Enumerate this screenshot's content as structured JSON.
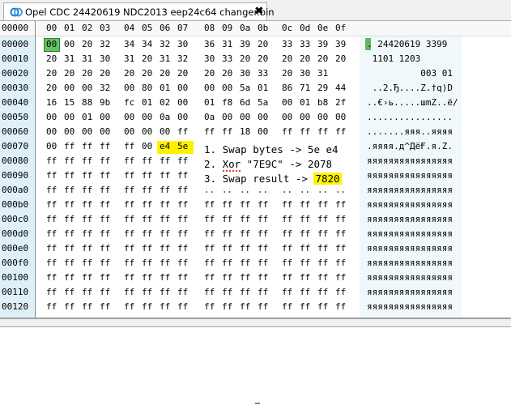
{
  "tab": {
    "title": "Opel CDC 24420619 NDC2013 eep24c64 changer.bin",
    "close": "✖"
  },
  "header": {
    "corner": "00000",
    "cols": [
      "00",
      "01",
      "02",
      "03",
      "04",
      "05",
      "06",
      "07",
      "08",
      "09",
      "0a",
      "0b",
      "0c",
      "0d",
      "0e",
      "0f"
    ]
  },
  "rows": [
    {
      "addr": "00000",
      "hex": [
        "00",
        "00",
        "20",
        "32",
        "34",
        "34",
        "32",
        "30",
        "36",
        "31",
        "39",
        "20",
        "33",
        "33",
        "39",
        "39"
      ],
      "ascii": ". 24420619 3399"
    },
    {
      "addr": "00010",
      "hex": [
        "20",
        "31",
        "31",
        "30",
        "31",
        "20",
        "31",
        "32",
        "30",
        "33",
        "20",
        "20",
        "20",
        "20",
        "20",
        "20"
      ],
      "ascii": " 1101 1203"
    },
    {
      "addr": "00020",
      "hex": [
        "20",
        "20",
        "20",
        "20",
        "20",
        "20",
        "20",
        "20",
        "20",
        "20",
        "30",
        "33",
        "20",
        "30",
        "31"
      ],
      "ascii": "          003 01"
    },
    {
      "addr": "00030",
      "hex": [
        "20",
        "00",
        "00",
        "32",
        "00",
        "80",
        "01",
        "00",
        "00",
        "00",
        "5a",
        "01",
        "86",
        "71",
        "29",
        "44"
      ],
      "ascii": " ..2.Ђ....Z.†q)D"
    },
    {
      "addr": "00040",
      "hex": [
        "16",
        "15",
        "88",
        "9b",
        "fc",
        "01",
        "02",
        "00",
        "01",
        "f8",
        "6d",
        "5a",
        "00",
        "01",
        "b8",
        "2f"
      ],
      "ascii": "..€›ь.....шmZ..ё/"
    },
    {
      "addr": "00050",
      "hex": [
        "00",
        "00",
        "01",
        "00",
        "00",
        "00",
        "0a",
        "00",
        "0a",
        "00",
        "00",
        "00",
        "00",
        "00",
        "00",
        "00"
      ],
      "ascii": "................"
    },
    {
      "addr": "00060",
      "hex": [
        "00",
        "00",
        "00",
        "00",
        "00",
        "00",
        "00",
        "ff",
        "ff",
        "ff",
        "18",
        "00",
        "ff",
        "ff",
        "ff",
        "ff"
      ],
      "ascii": ".......яяя..яяяя"
    },
    {
      "addr": "00070",
      "hex": [
        "00",
        "ff",
        "ff",
        "ff",
        "ff",
        "00",
        "e4",
        "5e",
        "",
        "",
        "",
        "",
        "",
        "",
        "",
        ""
      ],
      "ascii": ".яяяя.д^ДёҒ.я.Z."
    },
    {
      "addr": "00080",
      "hex": [
        "ff",
        "ff",
        "ff",
        "ff",
        "ff",
        "ff",
        "ff",
        "ff",
        "",
        "",
        "",
        "",
        "",
        "",
        "",
        ""
      ],
      "ascii": "яяяяяяяяяяяяяяяя"
    },
    {
      "addr": "00090",
      "hex": [
        "ff",
        "ff",
        "ff",
        "ff",
        "ff",
        "ff",
        "ff",
        "ff",
        "",
        "",
        "",
        "",
        "",
        "",
        "",
        ""
      ],
      "ascii": "яяяяяяяяяяяяяяяя"
    },
    {
      "addr": "000a0",
      "hex": [
        "ff",
        "ff",
        "ff",
        "ff",
        "ff",
        "ff",
        "ff",
        "ff",
        "ff",
        "ff",
        "ff",
        "ff",
        "ff",
        "ff",
        "ff",
        "ff"
      ],
      "ascii": "яяяяяяяяяяяяяяяя"
    },
    {
      "addr": "000b0",
      "hex": [
        "ff",
        "ff",
        "ff",
        "ff",
        "ff",
        "ff",
        "ff",
        "ff",
        "ff",
        "ff",
        "ff",
        "ff",
        "ff",
        "ff",
        "ff",
        "ff"
      ],
      "ascii": "яяяяяяяяяяяяяяяя"
    },
    {
      "addr": "000c0",
      "hex": [
        "ff",
        "ff",
        "ff",
        "ff",
        "ff",
        "ff",
        "ff",
        "ff",
        "ff",
        "ff",
        "ff",
        "ff",
        "ff",
        "ff",
        "ff",
        "ff"
      ],
      "ascii": "яяяяяяяяяяяяяяяя"
    },
    {
      "addr": "000d0",
      "hex": [
        "ff",
        "ff",
        "ff",
        "ff",
        "ff",
        "ff",
        "ff",
        "ff",
        "ff",
        "ff",
        "ff",
        "ff",
        "ff",
        "ff",
        "ff",
        "ff"
      ],
      "ascii": "яяяяяяяяяяяяяяяя"
    },
    {
      "addr": "000e0",
      "hex": [
        "ff",
        "ff",
        "ff",
        "ff",
        "ff",
        "ff",
        "ff",
        "ff",
        "ff",
        "ff",
        "ff",
        "ff",
        "ff",
        "ff",
        "ff",
        "ff"
      ],
      "ascii": "яяяяяяяяяяяяяяяя"
    },
    {
      "addr": "000f0",
      "hex": [
        "ff",
        "ff",
        "ff",
        "ff",
        "ff",
        "ff",
        "ff",
        "ff",
        "ff",
        "ff",
        "ff",
        "ff",
        "ff",
        "ff",
        "ff",
        "ff"
      ],
      "ascii": "яяяяяяяяяяяяяяяя"
    },
    {
      "addr": "00100",
      "hex": [
        "ff",
        "ff",
        "ff",
        "ff",
        "ff",
        "ff",
        "ff",
        "ff",
        "ff",
        "ff",
        "ff",
        "ff",
        "ff",
        "ff",
        "ff",
        "ff"
      ],
      "ascii": "яяяяяяяяяяяяяяяя"
    },
    {
      "addr": "00110",
      "hex": [
        "ff",
        "ff",
        "ff",
        "ff",
        "ff",
        "ff",
        "ff",
        "ff",
        "ff",
        "ff",
        "ff",
        "ff",
        "ff",
        "ff",
        "ff",
        "ff"
      ],
      "ascii": "яяяяяяяяяяяяяяяя"
    },
    {
      "addr": "00120",
      "hex": [
        "ff",
        "ff",
        "ff",
        "ff",
        "ff",
        "ff",
        "ff",
        "ff",
        "ff",
        "ff",
        "ff",
        "ff",
        "ff",
        "ff",
        "ff",
        "ff"
      ],
      "ascii": "яяяяяяяяяяяяяяяя"
    }
  ],
  "overlay": {
    "line1": "1. Swap bytes -> 5e e4",
    "line2_prefix": "2. ",
    "line2_word": "Xor",
    "line2_rest": " \"7E9C\" -> 2078",
    "line3_prefix": "3. Swap result -> ",
    "line3_value": "7820"
  },
  "colors": {
    "selection": "#62c462",
    "highlight": "#fff200",
    "address_bg": "#dff0f8"
  }
}
